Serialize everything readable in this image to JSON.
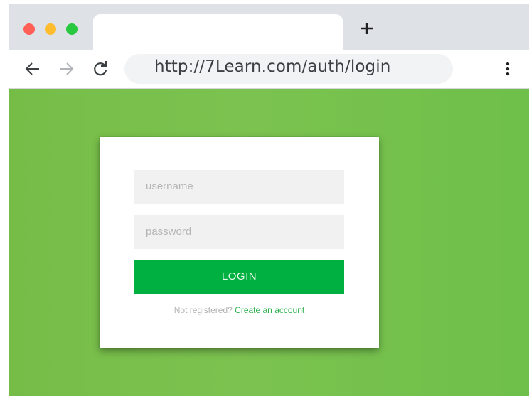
{
  "browser": {
    "url": "http://7Learn.com/auth/login",
    "new_tab_icon": "plus-icon",
    "back_icon": "arrow-left-icon",
    "forward_icon": "arrow-right-icon",
    "reload_icon": "reload-icon",
    "menu_icon": "kebab-menu-icon"
  },
  "login": {
    "username_placeholder": "username",
    "password_placeholder": "password",
    "button_label": "LOGIN",
    "register_prompt": "Not registered?",
    "register_link": "Create an account"
  },
  "colors": {
    "page_background": "#7cc250",
    "button": "#00b142",
    "link": "#2db04f"
  }
}
